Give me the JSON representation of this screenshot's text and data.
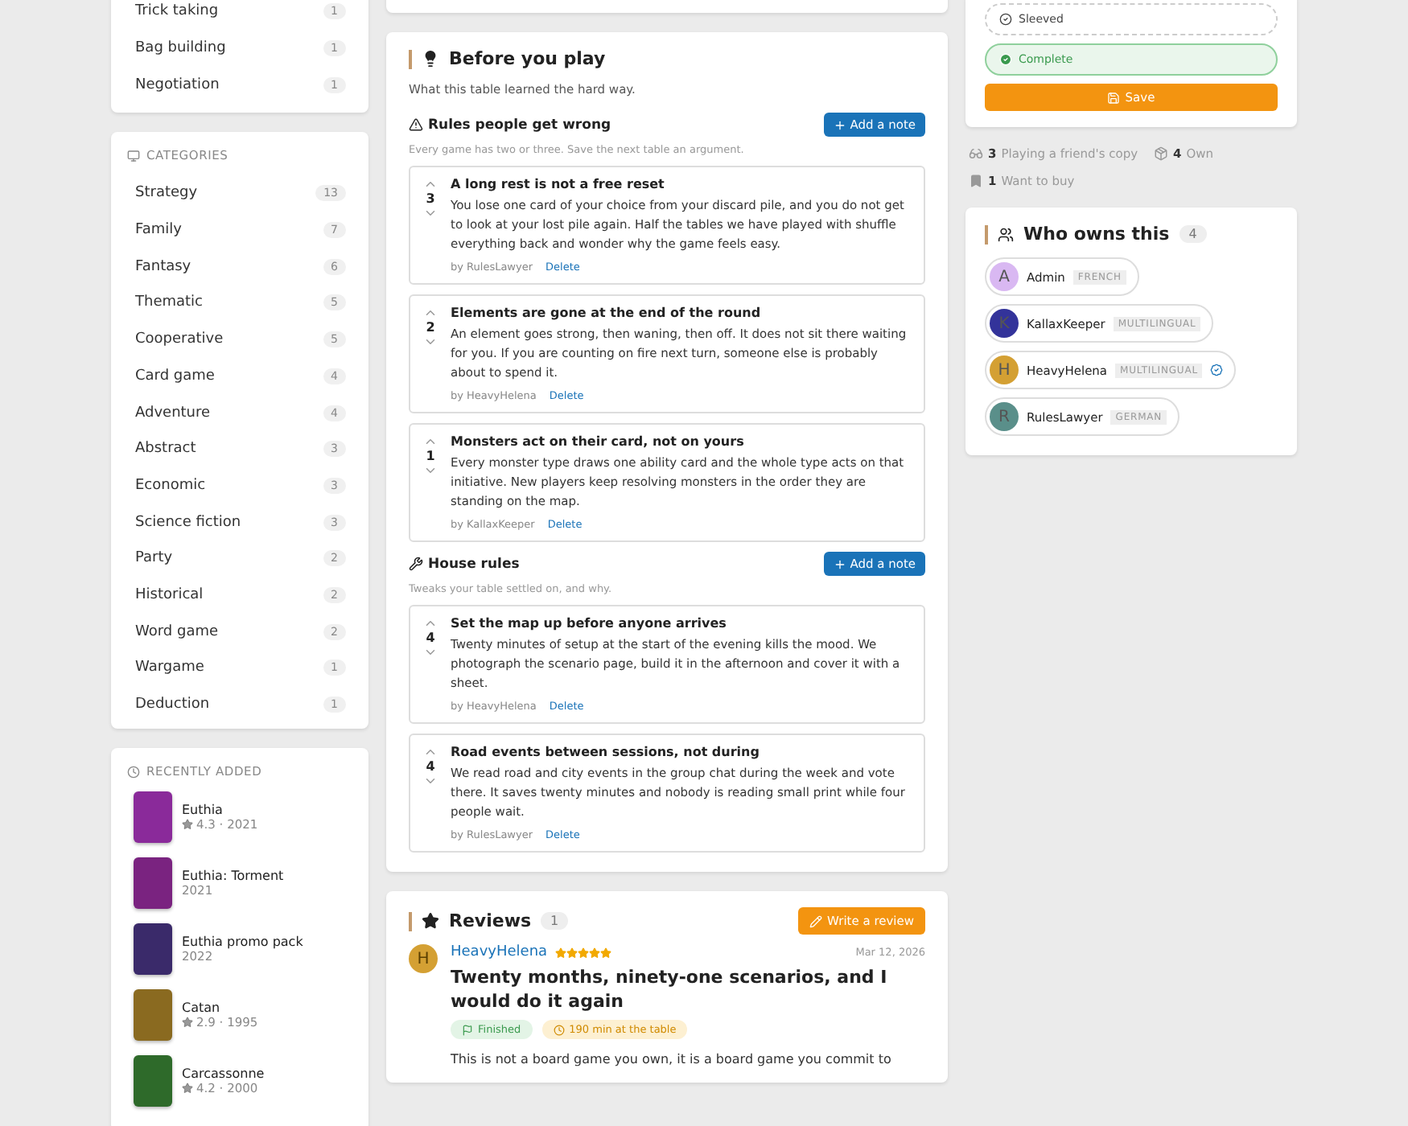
{
  "mechanics": {
    "items": [
      {
        "label": "Trick taking",
        "count": "1"
      },
      {
        "label": "Bag building",
        "count": "1"
      },
      {
        "label": "Negotiation",
        "count": "1"
      }
    ]
  },
  "categories": {
    "title": "CATEGORIES",
    "items": [
      {
        "label": "Strategy",
        "count": "13"
      },
      {
        "label": "Family",
        "count": "7"
      },
      {
        "label": "Fantasy",
        "count": "6"
      },
      {
        "label": "Thematic",
        "count": "5"
      },
      {
        "label": "Cooperative",
        "count": "5"
      },
      {
        "label": "Card game",
        "count": "4"
      },
      {
        "label": "Adventure",
        "count": "4"
      },
      {
        "label": "Abstract",
        "count": "3"
      },
      {
        "label": "Economic",
        "count": "3"
      },
      {
        "label": "Science fiction",
        "count": "3"
      },
      {
        "label": "Party",
        "count": "2"
      },
      {
        "label": "Historical",
        "count": "2"
      },
      {
        "label": "Word game",
        "count": "2"
      },
      {
        "label": "Wargame",
        "count": "1"
      },
      {
        "label": "Deduction",
        "count": "1"
      }
    ]
  },
  "recently_added": {
    "title": "RECENTLY ADDED",
    "items": [
      {
        "name": "Euthia",
        "meta": "4.3 · 2021",
        "rated": true,
        "color": "#8a2a9a"
      },
      {
        "name": "Euthia: Torment",
        "meta": "2021",
        "rated": false,
        "color": "#7a2380"
      },
      {
        "name": "Euthia promo pack",
        "meta": "2022",
        "rated": false,
        "color": "#3a2a6a"
      },
      {
        "name": "Catan",
        "meta": "2.9 · 1995",
        "rated": true,
        "color": "#8a6a20"
      },
      {
        "name": "Carcassonne",
        "meta": "4.2 · 2000",
        "rated": true,
        "color": "#2e6a2a"
      }
    ]
  },
  "before_you_play": {
    "title": "Before you play",
    "subtitle": "What this table learned the hard way.",
    "sections": [
      {
        "kind": "warning",
        "title": "Rules people get wrong",
        "hint": "Every game has two or three. Save the next table an argument.",
        "button": "Add a note",
        "notes": [
          {
            "title": "A long rest is not a free reset",
            "votes": "3",
            "body": "You lose one card of your choice from your discard pile, and you do not get to look at your lost pile again. Half the tables we have played with shuffle everything back and wonder why the game feels easy.",
            "author": "by RulesLawyer",
            "action": "Delete"
          },
          {
            "title": "Elements are gone at the end of the round",
            "votes": "2",
            "body": "An element goes strong, then waning, then off. It does not sit there waiting for you. If you are counting on fire next turn, someone else is probably about to spend it.",
            "author": "by HeavyHelena",
            "action": "Delete"
          },
          {
            "title": "Monsters act on their card, not on yours",
            "votes": "1",
            "body": "Every monster type draws one ability card and the whole type acts on that initiative. New players keep resolving monsters in the order they are standing on the map.",
            "author": "by KallaxKeeper",
            "action": "Delete"
          }
        ]
      },
      {
        "kind": "tools",
        "title": "House rules",
        "hint": "Tweaks your table settled on, and why.",
        "button": "Add a note",
        "notes": [
          {
            "title": "Set the map up before anyone arrives",
            "votes": "4",
            "body": "Twenty minutes of setup at the start of the evening kills the mood. We photograph the scenario page, build it in the afternoon and cover it with a sheet.",
            "author": "by HeavyHelena",
            "action": "Delete"
          },
          {
            "title": "Road events between sessions, not during",
            "votes": "4",
            "body": "We read road and city events in the group chat during the week and vote there. It saves twenty minutes and nobody is reading small print while four people wait.",
            "author": "by RulesLawyer",
            "action": "Delete"
          }
        ]
      }
    ]
  },
  "reviews": {
    "title": "Reviews",
    "count": "1",
    "button": "Write a review",
    "items": [
      {
        "initial": "H",
        "author": "HeavyHelena",
        "stars": 5,
        "date": "Mar 12, 2026",
        "title": "Twenty months, ninety-one scenarios, and I would do it again",
        "tags": [
          {
            "kind": "finished",
            "label": "Finished"
          },
          {
            "kind": "time",
            "label": "190 min at the table"
          }
        ],
        "body": "This is not a board game you own, it is a board game you commit to"
      }
    ]
  },
  "status": {
    "options": [
      {
        "label": "Sleeved",
        "selected": false
      },
      {
        "label": "Complete",
        "selected": true
      }
    ],
    "button": "Save"
  },
  "stats": [
    {
      "kind": "friend",
      "count": "3",
      "label": "Playing a friend's copy"
    },
    {
      "kind": "own",
      "count": "4",
      "label": "Own"
    },
    {
      "kind": "want",
      "count": "1",
      "label": "Want to buy"
    }
  ],
  "owners": {
    "title": "Who owns this",
    "count": "4",
    "items": [
      {
        "initial": "A",
        "name": "Admin",
        "language": "FRENCH",
        "color": "#d9b8f2",
        "verified": false
      },
      {
        "initial": "K",
        "name": "KallaxKeeper",
        "language": "MULTILINGUAL",
        "color": "#33339a",
        "verified": false
      },
      {
        "initial": "H",
        "name": "HeavyHelena",
        "language": "MULTILINGUAL",
        "color": "#d4a033",
        "verified": true
      },
      {
        "initial": "R",
        "name": "RulesLawyer",
        "language": "GERMAN",
        "color": "#5a8f8a",
        "verified": false
      }
    ]
  }
}
